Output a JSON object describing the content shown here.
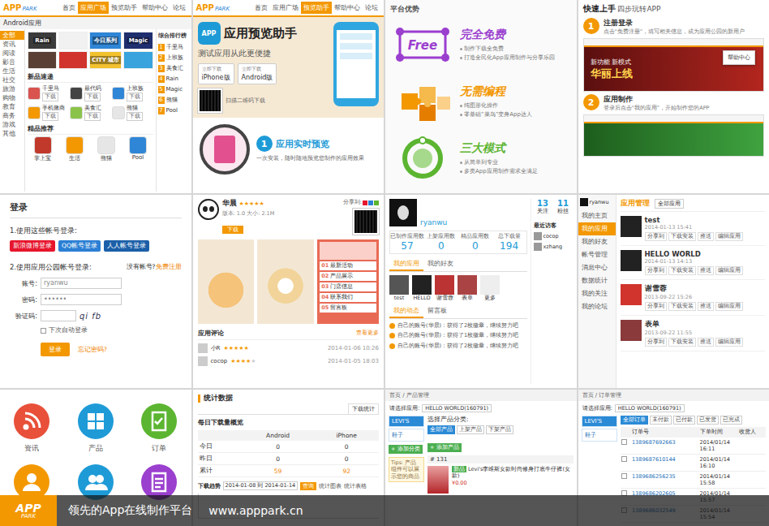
{
  "logo": {
    "mark": "APP",
    "word": "PARK"
  },
  "star_glyph": "★",
  "store": {
    "nav": [
      {
        "label": "首页",
        "selected": false
      },
      {
        "label": "应用广场",
        "selected": true
      },
      {
        "label": "预览助手",
        "selected": false
      },
      {
        "label": "帮助中心",
        "selected": false
      },
      {
        "label": "论坛",
        "selected": false
      }
    ],
    "breadcrumb": "Android应用",
    "categories": [
      {
        "label": "全部",
        "selected": true
      },
      {
        "label": "资讯",
        "selected": false
      },
      {
        "label": "阅读",
        "selected": false
      },
      {
        "label": "影音",
        "selected": false
      },
      {
        "label": "生活",
        "selected": false
      },
      {
        "label": "社交",
        "selected": false
      },
      {
        "label": "旅游",
        "selected": false
      },
      {
        "label": "购物",
        "selected": false
      },
      {
        "label": "教育",
        "selected": false
      },
      {
        "label": "商务",
        "selected": false
      },
      {
        "label": "游戏",
        "selected": false
      },
      {
        "label": "其他",
        "selected": false
      }
    ],
    "banners": [
      {
        "label": "Rain",
        "color": "#3b3b3b"
      },
      {
        "color": "#f1f1f1"
      },
      {
        "label": "今日系列",
        "color": "#2f86d6"
      },
      {
        "label": "Magic",
        "color": "#1f2e6e"
      },
      {
        "color": "#5a4034"
      },
      {
        "color": "#d0342c"
      },
      {
        "label": "CITY 城市",
        "color": "#f2c12e"
      },
      {
        "color": "#38a3dc"
      }
    ],
    "new_title": "新品速递",
    "download": "下载",
    "new_apps": [
      {
        "name": "千里马",
        "color": "#d9534f"
      },
      {
        "name": "最代码",
        "color": "#444444"
      },
      {
        "name": "上班族",
        "color": "#2f86d6"
      },
      {
        "name": "手机微商",
        "color": "#f39800"
      },
      {
        "name": "美食汇",
        "color": "#8bc34a"
      },
      {
        "name": "熊猫",
        "color": "#e6e6e6"
      }
    ],
    "hot_title": "精品推荐",
    "hot_apps": [
      {
        "name": "掌上宝",
        "color": "#c0392b"
      },
      {
        "name": "生活",
        "color": "#f39800"
      },
      {
        "name": "熊猫",
        "color": "#e6e6e6"
      },
      {
        "name": "Pool",
        "color": "#2f86d6"
      }
    ],
    "rank_title": "综合排行榜",
    "ranks": [
      {
        "num": "1",
        "name": "千里马"
      },
      {
        "num": "2",
        "name": "上班族"
      },
      {
        "num": "3",
        "name": "美食汇"
      },
      {
        "num": "4",
        "name": "Rain"
      },
      {
        "num": "5",
        "name": "Magic"
      },
      {
        "num": "6",
        "name": "熊猫"
      },
      {
        "num": "7",
        "name": "Pool"
      }
    ]
  },
  "preview": {
    "nav": [
      {
        "label": "首页",
        "selected": false
      },
      {
        "label": "应用广场",
        "selected": false
      },
      {
        "label": "预览助手",
        "selected": true
      },
      {
        "label": "帮助中心",
        "selected": false
      },
      {
        "label": "论坛",
        "selected": false
      }
    ],
    "title": "应用预览助手",
    "subtitle": "测试应用从此更便捷",
    "buttons": [
      {
        "top": "立即下载",
        "label": "iPhone版"
      },
      {
        "top": "立即下载",
        "label": "Android版"
      }
    ],
    "qr_note": "扫描二维码下载",
    "step": {
      "num": "1",
      "title": "应用实时预览",
      "text": "一次安装，随时随地预览您制作的应用效果"
    }
  },
  "advantages": {
    "title": "平台优势",
    "features": [
      {
        "kind": "free",
        "badge": "Free",
        "title": "完全免费",
        "color": "#9b3fcf",
        "points": [
          "制作下载全免费",
          "打造全民化App应用制作与分享乐园"
        ]
      },
      {
        "kind": "puzzle",
        "title": "无需编程",
        "color": "#f39800",
        "points": [
          "纯图形化操作",
          "零基础“菜鸟”变身App达人"
        ]
      },
      {
        "kind": "ring",
        "title": "三大模式",
        "color": "#5cb531",
        "points": [
          "从简单到专业",
          "多类App应用制作需求全满足"
        ]
      }
    ]
  },
  "quickstart": {
    "title": "快速上手",
    "subtitle": "四步玩转APP",
    "steps": [
      {
        "num": "1",
        "title": "注册登录",
        "text": "点击“免费注册”，填写相关信息，成为应用公园的新用户"
      },
      {
        "num": "2",
        "title": "应用制作",
        "text": "登录后点击“我的应用”，开始制作您的APP"
      }
    ],
    "menu_item": "帮助中心",
    "promo": "华丽上线",
    "promo2": "新功能 新模式"
  },
  "login": {
    "title": "登录",
    "third_title": "1.使用这些帐号登录:",
    "third": [
      {
        "label": "新浪微博登录",
        "color": "#e6162d"
      },
      {
        "label": "QQ帐号登录",
        "color": "#2b7fd4"
      },
      {
        "label": "人人帐号登录",
        "color": "#1b5fa8"
      }
    ],
    "site_title": "2.使用应用公园帐号登录:",
    "no_account": "没有帐号?",
    "register": "免费注册",
    "fields": [
      {
        "label": "账号:",
        "value": "ryanwu"
      },
      {
        "label": "密码:",
        "value": "••••••"
      }
    ],
    "captcha": {
      "label": "验证码:",
      "code": "qi fb"
    },
    "remember": {
      "label": "下次自动登录",
      "checked": false
    },
    "submit": "登录",
    "forgot": "忘记密码?"
  },
  "detail": {
    "app": {
      "name": "华晨",
      "stars": 5,
      "meta": "版本: 1.0  大小: 2.1M",
      "download": "下载"
    },
    "share": "分享到:",
    "menu": [
      {
        "num": "01",
        "label": "最新活动"
      },
      {
        "num": "02",
        "label": "产品展示"
      },
      {
        "num": "03",
        "label": "门店信息"
      },
      {
        "num": "04",
        "label": "联系我们"
      },
      {
        "num": "05",
        "label": "留言板"
      }
    ],
    "comments_title": "应用评论",
    "more": "查看更多",
    "comments": [
      {
        "user": "小R",
        "stars": 5,
        "date": "2014-01-06 10:26"
      },
      {
        "user": "cocop",
        "stars": 4,
        "date": "2014-01-05 18:03"
      }
    ]
  },
  "profile": {
    "user": "ryanwu",
    "stats": [
      {
        "label": "已制作应用数",
        "value": "57"
      },
      {
        "label": "上架应用数",
        "value": "0"
      },
      {
        "label": "精品应用数",
        "value": "0"
      },
      {
        "label": "总下载量",
        "value": "194"
      }
    ],
    "follow": [
      {
        "value": "13",
        "label": "关注"
      },
      {
        "value": "11",
        "label": "粉丝"
      }
    ],
    "recent_title": "最近访客",
    "visitors": [
      {
        "name": "cocop"
      },
      {
        "name": "xzhang"
      }
    ],
    "tabs": [
      {
        "label": "我的应用",
        "selected": true
      },
      {
        "label": "我的好友",
        "selected": false
      }
    ],
    "apps": [
      "test",
      "HELLO",
      "谢雪蓉",
      "表单",
      "更多"
    ],
    "feed_tabs": [
      {
        "label": "我的动态",
        "selected": true
      },
      {
        "label": "留言板",
        "selected": false
      }
    ],
    "feed": [
      "自己的账号(华晨)：获得了2枚徽章，继续努力吧",
      "自己的账号(华晨)：获得了1枚徽章，继续努力吧",
      "自己的账号(华晨)：获得了2枚徽章，继续努力吧"
    ]
  },
  "manage": {
    "user": "ryanwu",
    "sidebar": [
      {
        "label": "我的主页",
        "selected": false
      },
      {
        "label": "我的应用",
        "selected": true
      },
      {
        "label": "我的好友",
        "selected": false
      },
      {
        "label": "帐号管理",
        "selected": false
      },
      {
        "label": "消息中心",
        "selected": false
      },
      {
        "label": "数据统计",
        "selected": false
      },
      {
        "label": "我的关注",
        "selected": false
      },
      {
        "label": "我的论坛",
        "selected": false
      }
    ],
    "title": "应用管理",
    "filter": "全部应用",
    "actions": [
      "分享到",
      "下载安装",
      "推送",
      "编辑应用"
    ],
    "apps": [
      {
        "name": "test",
        "date": "2014-01-13 15:41"
      },
      {
        "name": "HELLO WORLD",
        "date": "2014-01-13 14:13"
      },
      {
        "name": "谢雪蓉",
        "date": "2013-09-22 15:26"
      },
      {
        "name": "表单",
        "date": "2013-09-22 11:55"
      }
    ]
  },
  "modules": {
    "items": [
      {
        "kind": "rss",
        "label": "资讯",
        "color": "#e8503a"
      },
      {
        "kind": "grid",
        "label": "产品",
        "color": "#1e9bd7"
      },
      {
        "kind": "order",
        "label": "订单",
        "color": "#5cb531"
      },
      {
        "kind": "person",
        "color": "#f39800"
      },
      {
        "kind": "people",
        "color": "#1e9bd7"
      },
      {
        "kind": "doc",
        "color": "#9b3fcf"
      }
    ]
  },
  "stats": {
    "title": "统计数据",
    "tab": "下载统计",
    "subtitle": "每日下载量概览",
    "columns": [
      "Android",
      "iPhone"
    ],
    "rows": [
      {
        "label": "今日",
        "android": "0",
        "iphone": "0",
        "highlight": false
      },
      {
        "label": "昨日",
        "android": "0",
        "iphone": "0",
        "highlight": false
      },
      {
        "label": "累计",
        "android": "59",
        "iphone": "92",
        "highlight": true
      }
    ],
    "trend": {
      "title": "下载趋势",
      "range": "2014-01-08 到 2014-01-14",
      "query": "查询",
      "links": [
        "统计图表",
        "统计表格"
      ]
    }
  },
  "products": {
    "breadcrumb": "首页 / 产品管理",
    "select_label": "请选择应用:",
    "select_value": "HELLO WORLD(160791)",
    "sidebar": [
      {
        "label": "LEVI'S",
        "selected": true
      },
      {
        "label": "鞋子",
        "selected": false
      }
    ],
    "add_category": "+ 添加分类",
    "category_label": "选择产品分类:",
    "filters": [
      {
        "label": "全部产品",
        "selected": true
      },
      {
        "label": "上架产品",
        "selected": false
      },
      {
        "label": "下架产品",
        "selected": false
      }
    ],
    "add_product": "+ 添加产品",
    "tips": "Tips: 产品组件可以展示您的商品",
    "product": {
      "id": "# 131",
      "tag": "新品",
      "name": "Levi's李维斯女款时尚修身打底牛仔裤(女款)",
      "price": "¥0.00"
    }
  },
  "orders": {
    "breadcrumb": "首页 / 订单管理",
    "select_label": "请选择应用:",
    "select_value": "HELLO WORLD(160791)",
    "sidebar": [
      {
        "label": "LEVI'S",
        "selected": true
      },
      {
        "label": "鞋子",
        "selected": false
      }
    ],
    "filters": [
      {
        "label": "全部订单",
        "selected": true
      },
      {
        "label": "未付款",
        "selected": false
      },
      {
        "label": "已付款",
        "selected": false
      },
      {
        "label": "已发货",
        "selected": false
      },
      {
        "label": "已完成",
        "selected": false
      }
    ],
    "columns": [
      "订单号",
      "下单时间",
      "收货人"
    ],
    "rows": [
      {
        "id": "1389687692663",
        "time": "2014/01/14 16:11"
      },
      {
        "id": "1389687610144",
        "time": "2014/01/14 16:10"
      },
      {
        "id": "1389686256235",
        "time": "2014/01/14 15:58"
      },
      {
        "id": "1389686202605",
        "time": "2014/01/14 15:57"
      },
      {
        "id": "1389686032549",
        "time": "2014/01/14 15:54"
      }
    ]
  },
  "banner": {
    "slogan": "领先的App在线制作平台",
    "url": "www.apppark.cn"
  }
}
